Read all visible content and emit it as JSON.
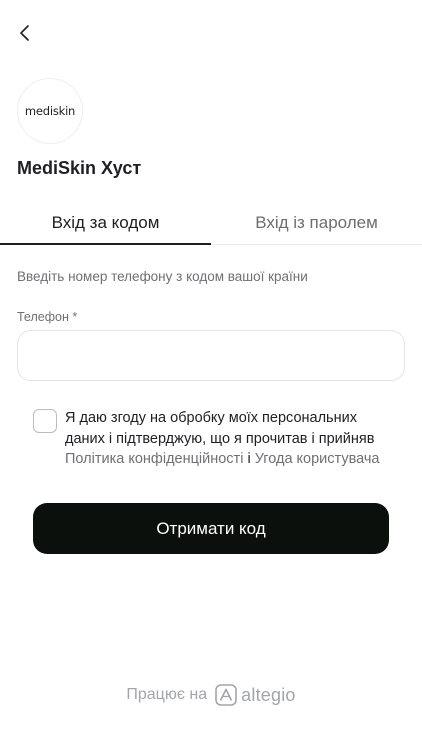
{
  "company": {
    "logo_text": "mediskin",
    "name": "MediSkin Хуст"
  },
  "tabs": [
    {
      "label": "Вхід за кодом",
      "active": true
    },
    {
      "label": "Вхід із паролем",
      "active": false
    }
  ],
  "form": {
    "hint": "Введіть номер телефону з кодом вашої країни",
    "phone_label": "Телефон *",
    "phone_value": "",
    "phone_placeholder": ""
  },
  "consent": {
    "text": "Я даю згоду на обробку моїх персональних даних і підтверджую, що я прочитав і прийняв",
    "privacy_link": "Політика конфіденційності",
    "and": "і",
    "terms_link": "Угода користувача",
    "checked": false
  },
  "submit_label": "Отримати код",
  "footer": {
    "powered": "Працює на",
    "brand": "altegio"
  },
  "icons": {
    "back": "chevron-left-icon",
    "brand": "altegio-logo-icon"
  },
  "colors": {
    "primary_button": "#0b100d",
    "muted_text": "#6e7076",
    "footer_text": "#a3a5aa"
  }
}
